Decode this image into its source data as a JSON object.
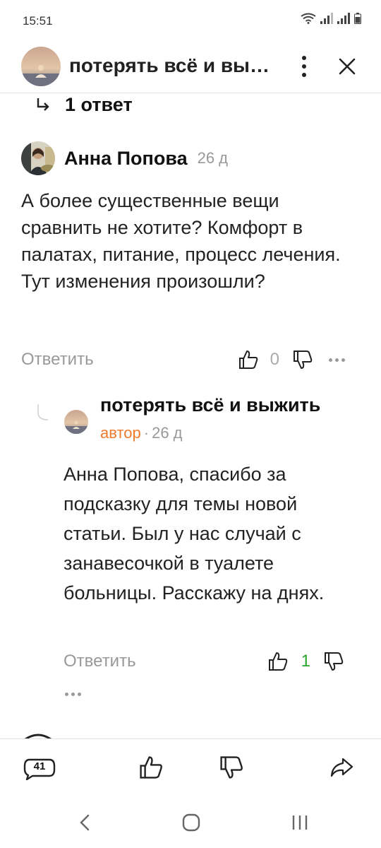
{
  "status_bar": {
    "time": "15:51",
    "icons": [
      "wifi-icon",
      "signal-icon",
      "signal-icon",
      "battery-icon"
    ]
  },
  "header": {
    "title": "потерять всё и выжить",
    "avatar_icon": "channel-avatar-icon",
    "menu_icon": "more-vertical-icon",
    "close_icon": "close-icon"
  },
  "replies_link": {
    "label": "1 ответ",
    "icon": "reply-arrow-icon"
  },
  "comment": {
    "author": "Анна Попова",
    "time": "26 д",
    "text": "А более существенные вещи сравнить не хотите? Комфорт в палатах, питание, процесс лечения. Тут изменения произошли?",
    "reply_label": "Ответить",
    "likes": "0",
    "like_icon": "thumbs-up-icon",
    "dislike_icon": "thumbs-down-icon",
    "more_icon": "more-horizontal-icon"
  },
  "reply": {
    "author": "потерять всё и выжить",
    "badge": "автор",
    "separator": "·",
    "time": "26 д",
    "text": "Анна Попова, спасибо за подсказку для темы новой статьи. Был у нас случай с занавесочкой в туалете больницы. Расскажу на днях.",
    "reply_label": "Ответить",
    "likes": "1",
    "likes_color": "#2aa52a",
    "like_icon": "thumbs-up-icon",
    "dislike_icon": "thumbs-down-icon",
    "more_icon": "more-horizontal-icon"
  },
  "bottom_bar": {
    "comments_count": "41",
    "comments_icon": "comments-bubble-icon",
    "like_icon": "thumbs-up-icon",
    "dislike_icon": "thumbs-down-icon",
    "share_icon": "share-icon"
  },
  "nav_bar": {
    "icons": [
      "back-icon",
      "home-icon",
      "recents-icon"
    ]
  }
}
